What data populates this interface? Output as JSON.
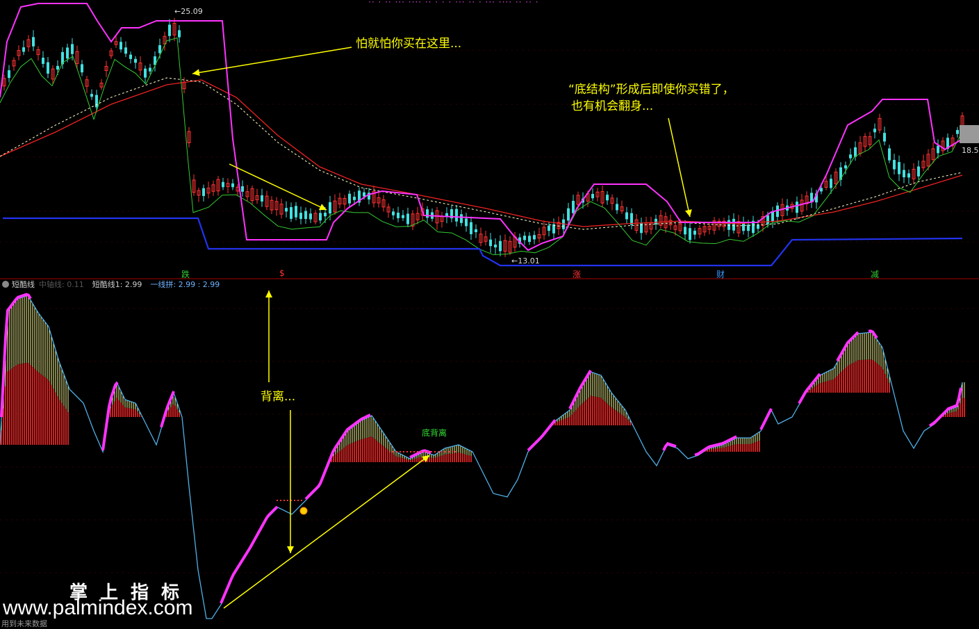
{
  "chart_data": {
    "type": "line",
    "price_panel": {
      "high_label": "25.09",
      "low_label": "13.01",
      "last_price_label": "18.5",
      "signals": [
        {
          "text": "跌",
          "color": "#33cc33"
        },
        {
          "text": "$",
          "color": "#ff3333"
        },
        {
          "text": "涨",
          "color": "#ff3333"
        },
        {
          "text": "财",
          "color": "#3399ff"
        },
        {
          "text": "减",
          "color": "#33cc33"
        }
      ]
    },
    "indicator_panel": {
      "name": "短酷线",
      "params": [
        {
          "label": "中轴线: 0.11",
          "color": "#555555"
        },
        {
          "label": "短酷线1: 2.99",
          "color": "#cccccc"
        },
        {
          "label": "一线拼: 2.99 : 2.99",
          "color": "#6fb3ff"
        }
      ],
      "divergence_label": "底背离"
    },
    "annotations": [
      {
        "id": "buy_here",
        "text": "怕就怕你买在这里..."
      },
      {
        "id": "bottom_structure_1",
        "text": "“底结构”形成后即使你买错了，"
      },
      {
        "id": "bottom_structure_2",
        "text": "也有机会翻身..."
      },
      {
        "id": "divergence",
        "text": "背离..."
      }
    ],
    "colors": {
      "up_candle": "#ff3333",
      "down_candle": "#44e0e0",
      "upper_band": "#ff33ff",
      "lower_band": "#2233ee",
      "ma_red": "#ee2222",
      "ma_dashed": "#ffffcc",
      "green_line": "#33cc33",
      "annotation": "#ffff00",
      "histo_red": "#cc2222",
      "histo_yellow": "#ffff99",
      "indicator_line": "#4fb0e8"
    }
  },
  "watermark": {
    "title": "掌上指标",
    "url": "www.palmindex.com"
  },
  "footer": {
    "note": "用到未来数据"
  }
}
